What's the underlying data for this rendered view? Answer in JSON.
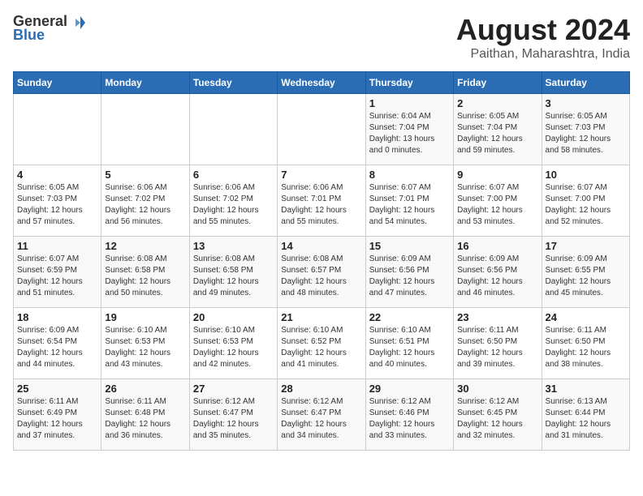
{
  "logo": {
    "general": "General",
    "blue": "Blue"
  },
  "title": "August 2024",
  "subtitle": "Paithan, Maharashtra, India",
  "weekdays": [
    "Sunday",
    "Monday",
    "Tuesday",
    "Wednesday",
    "Thursday",
    "Friday",
    "Saturday"
  ],
  "weeks": [
    [
      {
        "day": "",
        "info": ""
      },
      {
        "day": "",
        "info": ""
      },
      {
        "day": "",
        "info": ""
      },
      {
        "day": "",
        "info": ""
      },
      {
        "day": "1",
        "info": "Sunrise: 6:04 AM\nSunset: 7:04 PM\nDaylight: 13 hours\nand 0 minutes."
      },
      {
        "day": "2",
        "info": "Sunrise: 6:05 AM\nSunset: 7:04 PM\nDaylight: 12 hours\nand 59 minutes."
      },
      {
        "day": "3",
        "info": "Sunrise: 6:05 AM\nSunset: 7:03 PM\nDaylight: 12 hours\nand 58 minutes."
      }
    ],
    [
      {
        "day": "4",
        "info": "Sunrise: 6:05 AM\nSunset: 7:03 PM\nDaylight: 12 hours\nand 57 minutes."
      },
      {
        "day": "5",
        "info": "Sunrise: 6:06 AM\nSunset: 7:02 PM\nDaylight: 12 hours\nand 56 minutes."
      },
      {
        "day": "6",
        "info": "Sunrise: 6:06 AM\nSunset: 7:02 PM\nDaylight: 12 hours\nand 55 minutes."
      },
      {
        "day": "7",
        "info": "Sunrise: 6:06 AM\nSunset: 7:01 PM\nDaylight: 12 hours\nand 55 minutes."
      },
      {
        "day": "8",
        "info": "Sunrise: 6:07 AM\nSunset: 7:01 PM\nDaylight: 12 hours\nand 54 minutes."
      },
      {
        "day": "9",
        "info": "Sunrise: 6:07 AM\nSunset: 7:00 PM\nDaylight: 12 hours\nand 53 minutes."
      },
      {
        "day": "10",
        "info": "Sunrise: 6:07 AM\nSunset: 7:00 PM\nDaylight: 12 hours\nand 52 minutes."
      }
    ],
    [
      {
        "day": "11",
        "info": "Sunrise: 6:07 AM\nSunset: 6:59 PM\nDaylight: 12 hours\nand 51 minutes."
      },
      {
        "day": "12",
        "info": "Sunrise: 6:08 AM\nSunset: 6:58 PM\nDaylight: 12 hours\nand 50 minutes."
      },
      {
        "day": "13",
        "info": "Sunrise: 6:08 AM\nSunset: 6:58 PM\nDaylight: 12 hours\nand 49 minutes."
      },
      {
        "day": "14",
        "info": "Sunrise: 6:08 AM\nSunset: 6:57 PM\nDaylight: 12 hours\nand 48 minutes."
      },
      {
        "day": "15",
        "info": "Sunrise: 6:09 AM\nSunset: 6:56 PM\nDaylight: 12 hours\nand 47 minutes."
      },
      {
        "day": "16",
        "info": "Sunrise: 6:09 AM\nSunset: 6:56 PM\nDaylight: 12 hours\nand 46 minutes."
      },
      {
        "day": "17",
        "info": "Sunrise: 6:09 AM\nSunset: 6:55 PM\nDaylight: 12 hours\nand 45 minutes."
      }
    ],
    [
      {
        "day": "18",
        "info": "Sunrise: 6:09 AM\nSunset: 6:54 PM\nDaylight: 12 hours\nand 44 minutes."
      },
      {
        "day": "19",
        "info": "Sunrise: 6:10 AM\nSunset: 6:53 PM\nDaylight: 12 hours\nand 43 minutes."
      },
      {
        "day": "20",
        "info": "Sunrise: 6:10 AM\nSunset: 6:53 PM\nDaylight: 12 hours\nand 42 minutes."
      },
      {
        "day": "21",
        "info": "Sunrise: 6:10 AM\nSunset: 6:52 PM\nDaylight: 12 hours\nand 41 minutes."
      },
      {
        "day": "22",
        "info": "Sunrise: 6:10 AM\nSunset: 6:51 PM\nDaylight: 12 hours\nand 40 minutes."
      },
      {
        "day": "23",
        "info": "Sunrise: 6:11 AM\nSunset: 6:50 PM\nDaylight: 12 hours\nand 39 minutes."
      },
      {
        "day": "24",
        "info": "Sunrise: 6:11 AM\nSunset: 6:50 PM\nDaylight: 12 hours\nand 38 minutes."
      }
    ],
    [
      {
        "day": "25",
        "info": "Sunrise: 6:11 AM\nSunset: 6:49 PM\nDaylight: 12 hours\nand 37 minutes."
      },
      {
        "day": "26",
        "info": "Sunrise: 6:11 AM\nSunset: 6:48 PM\nDaylight: 12 hours\nand 36 minutes."
      },
      {
        "day": "27",
        "info": "Sunrise: 6:12 AM\nSunset: 6:47 PM\nDaylight: 12 hours\nand 35 minutes."
      },
      {
        "day": "28",
        "info": "Sunrise: 6:12 AM\nSunset: 6:47 PM\nDaylight: 12 hours\nand 34 minutes."
      },
      {
        "day": "29",
        "info": "Sunrise: 6:12 AM\nSunset: 6:46 PM\nDaylight: 12 hours\nand 33 minutes."
      },
      {
        "day": "30",
        "info": "Sunrise: 6:12 AM\nSunset: 6:45 PM\nDaylight: 12 hours\nand 32 minutes."
      },
      {
        "day": "31",
        "info": "Sunrise: 6:13 AM\nSunset: 6:44 PM\nDaylight: 12 hours\nand 31 minutes."
      }
    ]
  ]
}
